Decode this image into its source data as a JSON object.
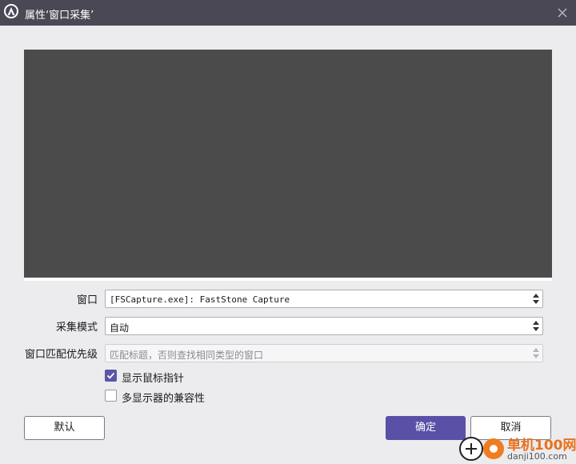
{
  "window": {
    "title": "属性‘窗口采集’",
    "close_icon": "close-icon"
  },
  "form": {
    "window": {
      "label": "窗口",
      "value": "[FSCapture.exe]: FastStone Capture"
    },
    "capture_mode": {
      "label": "采集模式",
      "value": "自动"
    },
    "match_priority": {
      "label": "窗口匹配优先级",
      "value": "匹配标题，否则查找相同类型的窗口",
      "disabled": true
    },
    "checkboxes": [
      {
        "label": "显示鼠标指针",
        "checked": true
      },
      {
        "label": "多显示器的兼容性",
        "checked": false
      }
    ]
  },
  "buttons": {
    "defaults": "默认",
    "ok": "确定",
    "cancel": "取消"
  },
  "watermark": {
    "cn": "单机100网",
    "en": "danji100.com"
  },
  "colors": {
    "titlebar": "#4a4855",
    "background": "#ecebee",
    "preview": "#4b4b4b",
    "accent": "#5851a6",
    "watermark_orange": "#f07c21"
  }
}
